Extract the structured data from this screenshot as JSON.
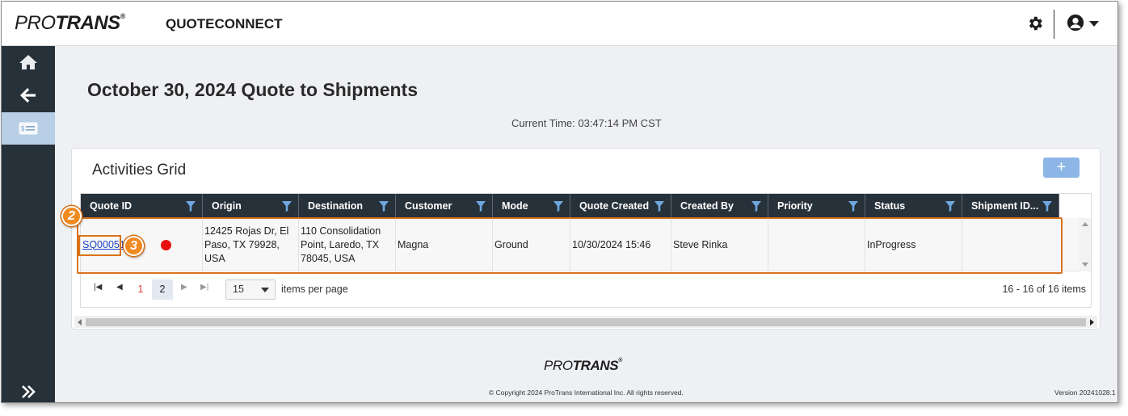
{
  "header": {
    "logo_part1": "PRO",
    "logo_part2": "TRANS",
    "logo_reg": "®",
    "app_title": "QUOTECONNECT"
  },
  "sidebar": {
    "items": [
      {
        "icon": "home-icon"
      },
      {
        "icon": "arrow-left-icon"
      },
      {
        "icon": "quote-card-icon",
        "active": true
      }
    ],
    "expand_icon": "double-chevron-right-icon"
  },
  "main": {
    "title": "October 30, 2024 Quote to Shipments",
    "current_time": "Current Time: 03:47:14 PM CST"
  },
  "grid": {
    "title": "Activities Grid",
    "add_label": "+",
    "columns": [
      "Quote ID",
      "Origin",
      "Destination",
      "Customer",
      "Mode",
      "Quote Created",
      "Created By",
      "Priority",
      "Status",
      "Shipment ID..."
    ],
    "rows": [
      {
        "quote_id": "SQ00051",
        "origin": "12425 Rojas Dr, El Paso, TX 79928, USA",
        "destination": "110 Consolidation Point, Laredo, TX 78045, USA",
        "customer": "Magna",
        "mode": "Ground",
        "quote_created": "10/30/2024 15:46",
        "created_by": "Steve Rinka",
        "priority": "",
        "status": "InProgress",
        "shipment_id": ""
      }
    ],
    "pager": {
      "pages": [
        "1",
        "2"
      ],
      "page_size": "15",
      "items_per_page_label": "items per page",
      "info": "16 - 16 of 16 items"
    }
  },
  "callouts": {
    "badge_2": "2",
    "badge_3": "3"
  },
  "footer": {
    "logo_part1": "PRO",
    "logo_part2": "TRANS",
    "logo_reg": "®",
    "copyright": "© Copyright 2024 ProTrans International Inc. All rights reserved.",
    "version": "Version 20241028.1"
  },
  "colors": {
    "sidebar": "#27313a",
    "grid_header": "#27313a",
    "accent_button": "#8cb6e6",
    "highlight": "#d9731a",
    "status_dot": "#e81010"
  }
}
